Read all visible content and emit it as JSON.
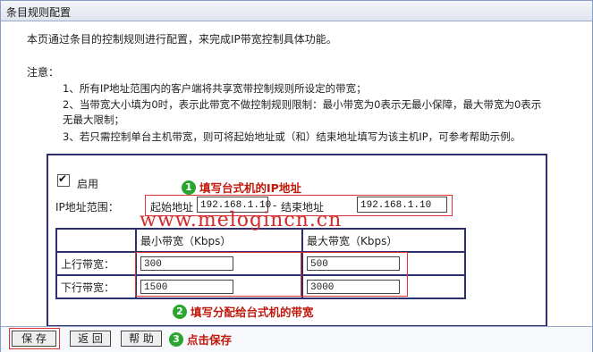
{
  "window": {
    "title": "条目规则配置"
  },
  "intro": "本页通过条目的控制规则进行配置，来完成IP带宽控制具体功能。",
  "notes": {
    "title": "注意：",
    "items": [
      "1、所有IP地址范围内的客户端将共享宽带控制规则所设定的带宽；",
      "2、当带宽大小填为0时，表示此带宽不做控制规则限制：最小带宽为0表示无最小保障，最大带宽为0表示",
      "无最大限制；",
      "3、若只需控制单台主机带宽，则可将起始地址或（和）结束地址填写为该主机IP，可参考帮助示例。"
    ]
  },
  "form": {
    "enable_label": "启用",
    "enable_checked": true,
    "ip_range_label": "IP地址范围：",
    "start_label": "起始地址",
    "start_value": "192.168.1.10",
    "dash": "-",
    "end_label": "结束地址",
    "end_value": "192.168.1.10"
  },
  "bandwidth_table": {
    "header_min": "最小带宽（Kbps）",
    "header_max": "最大带宽（Kbps）",
    "rows": [
      {
        "label": "上行带宽：",
        "min": "300",
        "max": "500"
      },
      {
        "label": "下行带宽：",
        "min": "1500",
        "max": "3000"
      }
    ]
  },
  "annotations": {
    "a1": {
      "num": "1",
      "text": "填写台式机的IP地址"
    },
    "a2": {
      "num": "2",
      "text": "填写分配给台式机的带宽"
    },
    "a3": {
      "num": "3",
      "text": "点击保存"
    }
  },
  "watermark": "www.melogincn.cn",
  "buttons": {
    "save": "保 存",
    "back": "返 回",
    "help": "帮 助"
  },
  "colors": {
    "annotation_red": "#c0180c",
    "step_green": "#2aa52d",
    "panel_border": "#2d2f6e"
  }
}
